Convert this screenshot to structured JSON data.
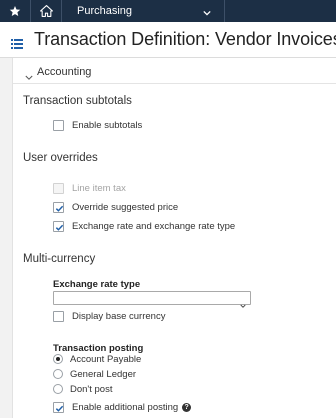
{
  "topbar": {
    "module": "Purchasing"
  },
  "header": {
    "title": "Transaction Definition: Vendor Invoices"
  },
  "section": {
    "title": "Accounting"
  },
  "subtotals": {
    "title": "Transaction subtotals",
    "enable_label": "Enable subtotals",
    "enable_checked": false
  },
  "overrides": {
    "title": "User overrides",
    "items": [
      {
        "label": "Line item tax",
        "checked": false,
        "disabled": true
      },
      {
        "label": "Override suggested price",
        "checked": true,
        "disabled": false
      },
      {
        "label": "Exchange rate and exchange rate type",
        "checked": true,
        "disabled": false
      }
    ]
  },
  "multicurrency": {
    "title": "Multi-currency",
    "rate_type_label": "Exchange rate type",
    "rate_type_value": "",
    "display_base_label": "Display base currency",
    "display_base_checked": false
  },
  "posting": {
    "label": "Transaction posting",
    "options": [
      {
        "label": "Account Payable",
        "selected": true
      },
      {
        "label": "General Ledger",
        "selected": false
      },
      {
        "label": "Don't post",
        "selected": false
      }
    ],
    "additional_label": "Enable additional posting",
    "additional_checked": true
  }
}
